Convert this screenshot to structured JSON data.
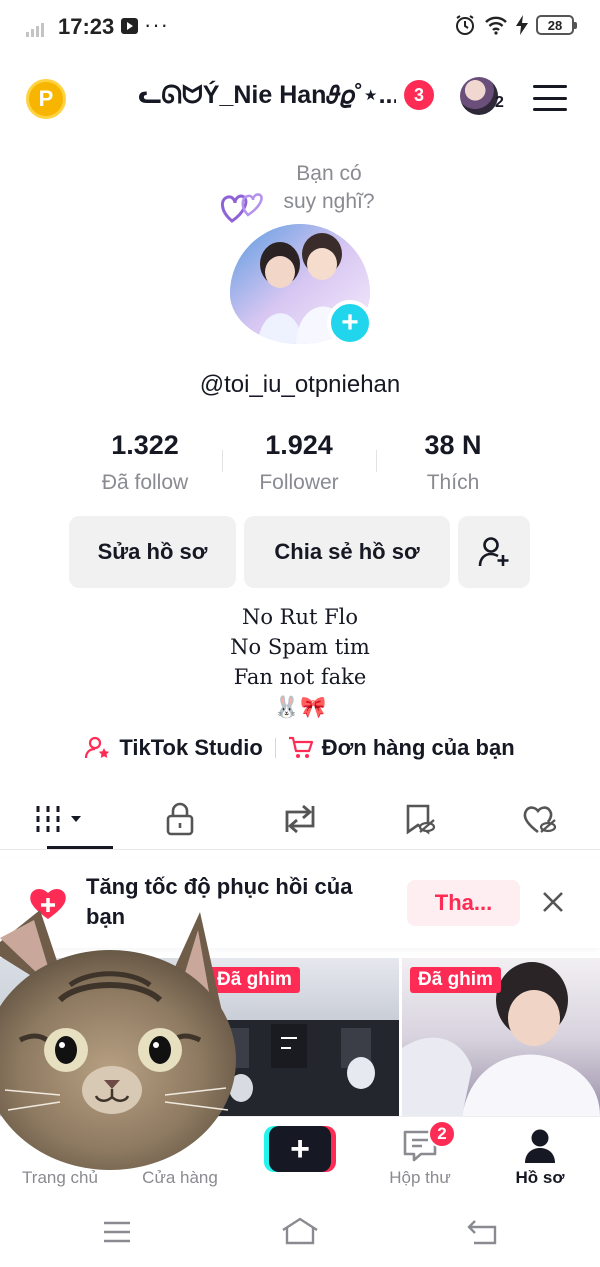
{
  "status_bar": {
    "time": "17:23",
    "overflow": "···",
    "battery": "28",
    "icons": [
      "signal-icon",
      "youtube-icon",
      "alarm-icon",
      "wifi-icon",
      "charging-icon",
      "battery-icon"
    ]
  },
  "header": {
    "coin_label": "P",
    "username": "ᓚᘏᗢÝ_Nie Han𝜗𝜚˚⋆...",
    "notification_count": "3",
    "account_count": "2"
  },
  "profile": {
    "thought_text": "Bạn có suy nghĩ?",
    "add_icon": "+",
    "handle": "@toi_iu_otpniehan",
    "stats": [
      {
        "value": "1.322",
        "label": "Đã follow"
      },
      {
        "value": "1.924",
        "label": "Follower"
      },
      {
        "value": "38 N",
        "label": "Thích"
      }
    ],
    "buttons": {
      "edit": "Sửa hồ sơ",
      "share": "Chia sẻ hồ sơ"
    },
    "bio": [
      "No Rut Flo",
      "No Spam tim",
      "Fan not fake",
      "🐰🎀"
    ],
    "links": {
      "studio": "TikTok Studio",
      "orders": "Đơn hàng của bạn"
    }
  },
  "tabs": [
    "videos",
    "private",
    "reposts",
    "favorites",
    "liked"
  ],
  "banner": {
    "text": "Tăng tốc độ phục hồi của bạn",
    "button": "Tha..."
  },
  "videos": [
    {
      "pinned_label": ""
    },
    {
      "pinned_label": "Đã ghim"
    },
    {
      "pinned_label": "Đã ghim"
    }
  ],
  "bottom_nav": {
    "home": "Trang chủ",
    "shop": "Cửa hàng",
    "create": "+",
    "inbox": "Hộp thư",
    "inbox_badge": "2",
    "profile": "Hồ sơ"
  },
  "colors": {
    "accent": "#fe2c55",
    "cyan": "#25f4ee",
    "text": "#161823",
    "muted": "#8a8b91",
    "button_bg": "#f1f1f2"
  }
}
